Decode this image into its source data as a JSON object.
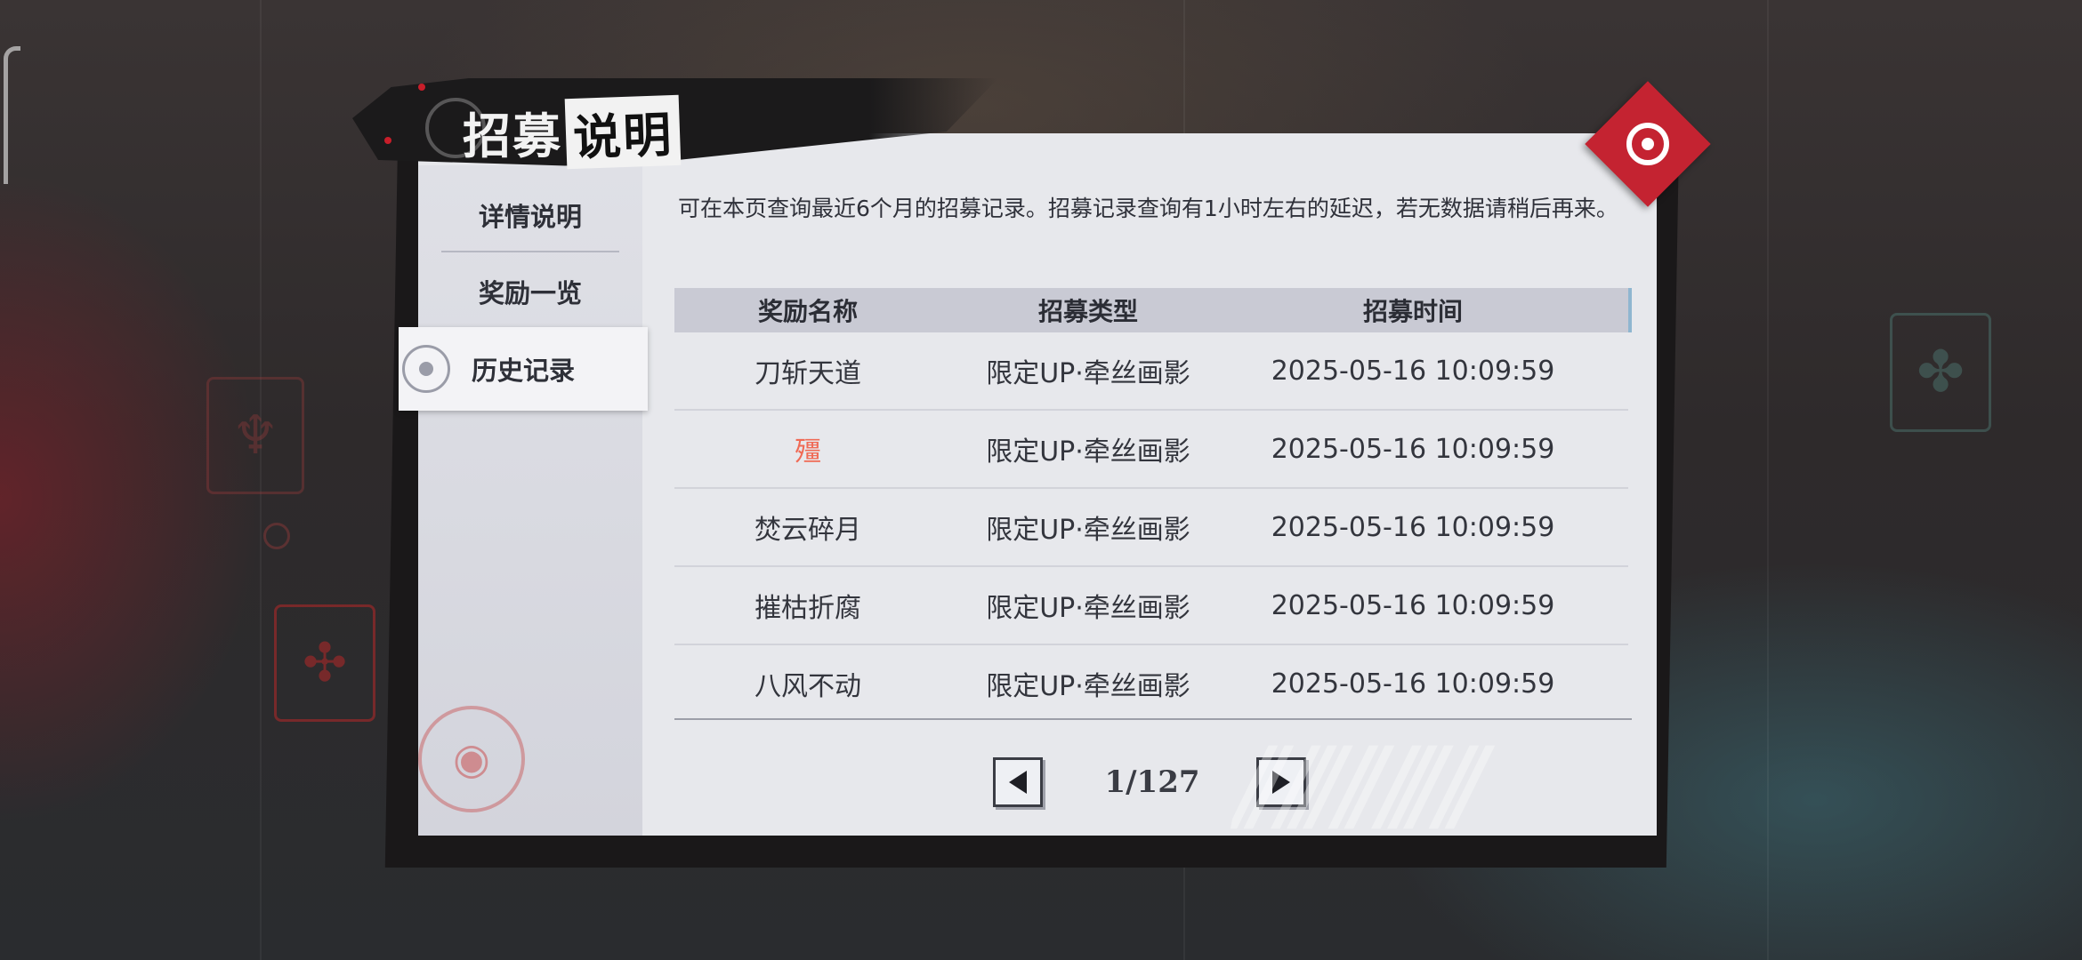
{
  "header": {
    "title_part1": "招募",
    "title_part2": "说明",
    "close_icon": "target-icon"
  },
  "sidebar": {
    "items": [
      {
        "label": "详情说明",
        "active": false
      },
      {
        "label": "奖励一览",
        "active": false
      },
      {
        "label": "历史记录",
        "active": true
      }
    ]
  },
  "content": {
    "note": "可在本页查询最近6个月的招募记录。招募记录查询有1小时左右的延迟，若无数据请稍后再来。",
    "table": {
      "headers": [
        "奖励名称",
        "招募类型",
        "招募时间"
      ],
      "rows": [
        {
          "name": "刀斩天道",
          "type": "限定UP·牵丝画影",
          "time": "2025-05-16 10:09:59",
          "highlight": false
        },
        {
          "name": "殭",
          "type": "限定UP·牵丝画影",
          "time": "2025-05-16 10:09:59",
          "highlight": true
        },
        {
          "name": "焚云碎月",
          "type": "限定UP·牵丝画影",
          "time": "2025-05-16 10:09:59",
          "highlight": false
        },
        {
          "name": "摧枯折腐",
          "type": "限定UP·牵丝画影",
          "time": "2025-05-16 10:09:59",
          "highlight": false
        },
        {
          "name": "八风不动",
          "type": "限定UP·牵丝画影",
          "time": "2025-05-16 10:09:59",
          "highlight": false
        }
      ]
    },
    "pagination": {
      "label": "1/127",
      "current": 1,
      "total": 127
    }
  },
  "colors": {
    "accent_red": "#c42331",
    "highlight_text": "#f06a55",
    "panel_bg": "#e7e8ec"
  }
}
